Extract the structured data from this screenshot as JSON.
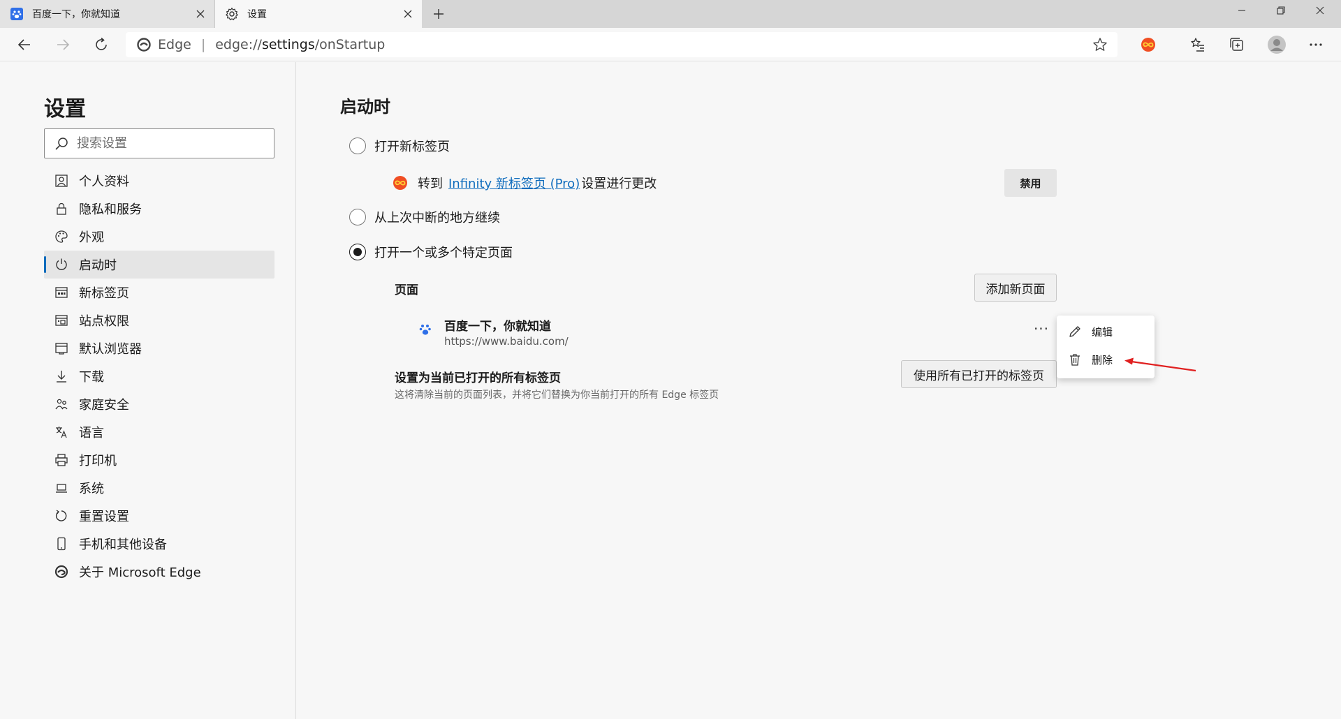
{
  "tabs": [
    {
      "title": "百度一下，你就知道",
      "icon": "baidu-paw-icon",
      "active": false
    },
    {
      "title": "设置",
      "icon": "gear-icon",
      "active": true
    }
  ],
  "address_bar": {
    "brand": "Edge",
    "separator": "|",
    "url_host": "edge://",
    "url_bold": "settings",
    "url_path": "/onStartup"
  },
  "sidebar": {
    "title": "设置",
    "search_placeholder": "搜索设置",
    "items": [
      {
        "label": "个人资料",
        "icon": "profile-icon"
      },
      {
        "label": "隐私和服务",
        "icon": "lock-icon"
      },
      {
        "label": "外观",
        "icon": "palette-icon"
      },
      {
        "label": "启动时",
        "icon": "power-icon",
        "selected": true
      },
      {
        "label": "新标签页",
        "icon": "newtab-icon"
      },
      {
        "label": "站点权限",
        "icon": "site-permissions-icon"
      },
      {
        "label": "默认浏览器",
        "icon": "browser-icon"
      },
      {
        "label": "下载",
        "icon": "download-icon"
      },
      {
        "label": "家庭安全",
        "icon": "family-icon"
      },
      {
        "label": "语言",
        "icon": "language-icon"
      },
      {
        "label": "打印机",
        "icon": "printer-icon"
      },
      {
        "label": "系统",
        "icon": "system-icon"
      },
      {
        "label": "重置设置",
        "icon": "reset-icon"
      },
      {
        "label": "手机和其他设备",
        "icon": "phone-icon"
      },
      {
        "label": "关于 Microsoft Edge",
        "icon": "edge-logo-icon"
      }
    ]
  },
  "main": {
    "title": "启动时",
    "option_new_tab": "打开新标签页",
    "extension_prefix": "转到",
    "extension_link": "Infinity 新标签页 (Pro)",
    "extension_suffix": "设置进行更改",
    "disable_button": "禁用",
    "option_continue": "从上次中断的地方继续",
    "option_specific": "打开一个或多个特定页面",
    "selected_option": "option_specific",
    "pages_label": "页面",
    "add_page_button": "添加新页面",
    "page": {
      "title": "百度一下，你就知道",
      "url": "https://www.baidu.com/"
    },
    "more_label": "···",
    "set_all_title": "设置为当前已打开的所有标签页",
    "set_all_desc": "这将清除当前的页面列表，并将它们替换为你当前打开的所有 Edge 标签页",
    "use_all_button": "使用所有已打开的标签页"
  },
  "context_menu": {
    "items": [
      {
        "label": "编辑",
        "icon": "pencil-icon"
      },
      {
        "label": "删除",
        "icon": "trash-icon"
      }
    ]
  },
  "colors": {
    "accent": "#0f6cbd",
    "annotation_arrow": "#e02020",
    "extension_icon": "#f04e23"
  }
}
